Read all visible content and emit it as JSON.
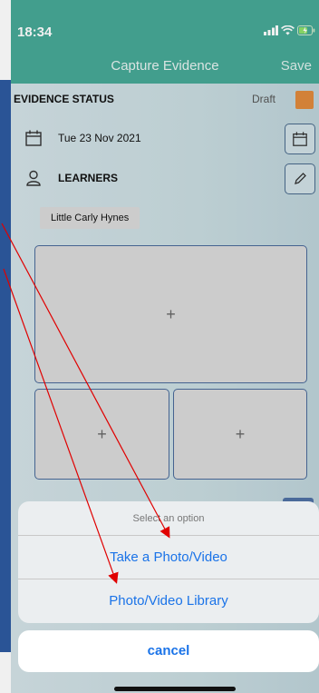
{
  "status_bar": {
    "time": "18:34"
  },
  "nav": {
    "title": "Capture Evidence",
    "save_label": "Save"
  },
  "evidence": {
    "status_label": "EVIDENCE STATUS",
    "status_value": "Draft",
    "status_color": "#e08a3c"
  },
  "date": {
    "value": "Tue 23 Nov 2021"
  },
  "learners": {
    "label": "LEARNERS",
    "chips": [
      "Little Carly  Hynes"
    ]
  },
  "media_tiles": {
    "add_symbol": "+"
  },
  "action_sheet": {
    "title": "Select an option",
    "options": [
      "Take a Photo/Video",
      "Photo/Video Library"
    ],
    "cancel_label": "cancel"
  },
  "colors": {
    "header": "#47a896",
    "accent": "#1a73e8",
    "annotation_arrow": "#e00000"
  }
}
